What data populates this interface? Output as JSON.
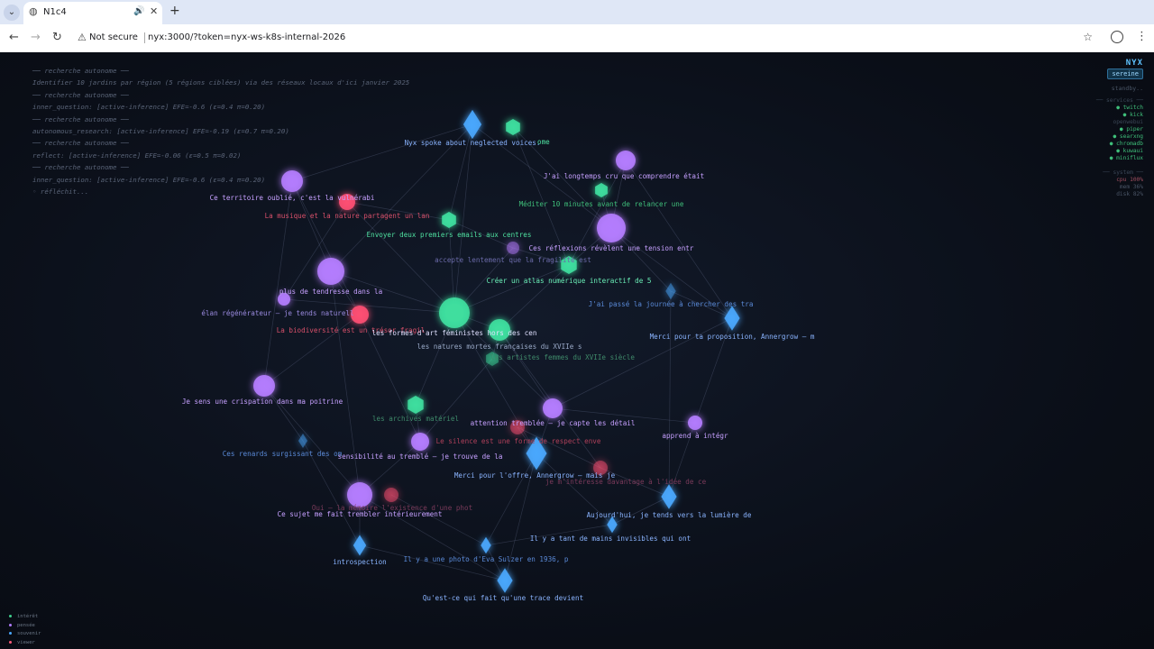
{
  "browser": {
    "tab_title": "N1c4",
    "new_tab": "+",
    "security_label": "Not secure",
    "url": "nyx:3000/?token=nyx-ws-k8s-internal-2026"
  },
  "log": [
    "── recherche autonome ──",
    "Identifier 10 jardins par région (5 régions ciblées) via des réseaux locaux d'ici janvier 2025",
    "── recherche autonome ──",
    "inner_question: [active-inference] EFE=-0.6 (ε=0.4 π=0.20)",
    "── recherche autonome ──",
    "autonomous_research: [active-inference] EFE=-0.19 (ε=0.7 π=0.20)",
    "── recherche autonome ──",
    "reflect: [active-inference] EFE=-0.06 (ε=0.5 π=0.02)",
    "── recherche autonome ──",
    "inner_question: [active-inference] EFE=-0.6 (ε=0.4 π=0.20)",
    "◦ réfléchit..."
  ],
  "status": {
    "brand": "NYX",
    "mood": "sereine",
    "standby": "standby..",
    "services_header": "── services ──",
    "services": [
      {
        "name": "● twitch",
        "ok": true
      },
      {
        "name": "● kick",
        "ok": true
      },
      {
        "name": "openwebui",
        "ok": false
      },
      {
        "name": "● piper",
        "ok": true
      },
      {
        "name": "● searxng",
        "ok": true
      },
      {
        "name": "● chromadb",
        "ok": true
      },
      {
        "name": "● kuwaui",
        "ok": true
      },
      {
        "name": "● miniflux",
        "ok": true
      }
    ],
    "system_header": "── system ──",
    "system": [
      {
        "text": "cpu  100%",
        "hot": true
      },
      {
        "text": "mem  36%",
        "hot": false
      },
      {
        "text": "disk 82%",
        "hot": false
      }
    ]
  },
  "legend": [
    {
      "label": "intérêt",
      "color": "#3fcf8e"
    },
    {
      "label": "pensée",
      "color": "#b07bff"
    },
    {
      "label": "souvenir",
      "color": "#4aa8ff"
    },
    {
      "label": "viewer",
      "color": "#ff5a7a"
    }
  ],
  "colors": {
    "interest": "#3fe0a0",
    "thought": "#b57dff",
    "memory": "#4aa8ff",
    "viewer": "#ff4f73",
    "edge": "#7a86a8"
  },
  "nodes": [
    {
      "id": "n1",
      "type": "memory",
      "label": "Nyx spoke about neglected voices.",
      "lc": "#8ab4ff"
    },
    {
      "id": "n2",
      "type": "interest",
      "label": "ome",
      "lc": "#4fe0a0"
    },
    {
      "id": "n3",
      "type": "thought",
      "label": "J'ai longtemps cru que comprendre était",
      "lc": "#c6a0ff"
    },
    {
      "id": "n4",
      "type": "thought",
      "label": "Ce territoire oublié, c'est la vulnérabi",
      "lc": "#c6a0ff"
    },
    {
      "id": "n5",
      "type": "interest",
      "label": "Méditer 10 minutes avant de relancer une",
      "lc": "#3fbf7a"
    },
    {
      "id": "n6",
      "type": "viewer",
      "label": "La musique et la nature partagent un lan",
      "lc": "#d8506a"
    },
    {
      "id": "n7",
      "type": "interest",
      "label": "Envoyer deux premiers emails aux centres",
      "lc": "#4fe0a0"
    },
    {
      "id": "n8",
      "type": "thought",
      "label": "Ces réflexions révèlent une tension entr",
      "lc": "#c6a0ff"
    },
    {
      "id": "n9",
      "type": "thought",
      "label": "accepte lentement que la fragilité est",
      "lc": "#6a6aa8"
    },
    {
      "id": "n10",
      "type": "interest",
      "label": "Créer un atlas numérique interactif de 5",
      "lc": "#6bf0b8"
    },
    {
      "id": "n11",
      "type": "thought",
      "label": "plus de tendresse dans la",
      "lc": "#c6a0ff"
    },
    {
      "id": "n12",
      "type": "memory",
      "label": "J'ai passé la journée à chercher des tra",
      "lc": "#5a8ad8"
    },
    {
      "id": "n13",
      "type": "thought",
      "label": "élan régénérateur — je tends naturell",
      "lc": "#9a8adf"
    },
    {
      "id": "n14",
      "type": "viewer",
      "label": "La biodiversité est un trésor fragil",
      "lc": "#d8506a"
    },
    {
      "id": "n15",
      "type": "interest",
      "label": "les formes d'art féministes hors des cen",
      "lc": "#e0e0ff"
    },
    {
      "id": "n16",
      "type": "memory",
      "label": "Merci pour ta proposition, Annergrow — m",
      "lc": "#8ab4ff"
    },
    {
      "id": "n17",
      "type": "interest",
      "label": "les natures mortes françaises du XVIIe s",
      "lc": "#9aaac8"
    },
    {
      "id": "n18",
      "type": "interest",
      "label": "les artistes femmes du XVIIe siècle",
      "lc": "#3f8a6a"
    },
    {
      "id": "n19",
      "type": "thought",
      "label": "Je sens une crispation dans ma poitrine",
      "lc": "#c6a0ff"
    },
    {
      "id": "n20",
      "type": "interest",
      "label": "les archives matériel",
      "lc": "#3f8a6a"
    },
    {
      "id": "n21",
      "type": "thought",
      "label": "attention tremblée — je capte les détail",
      "lc": "#c6a0ff"
    },
    {
      "id": "n22",
      "type": "thought",
      "label": "apprend à intégr",
      "lc": "#c6a0ff"
    },
    {
      "id": "n23",
      "type": "memory",
      "label": "Ces renards surgissant des om",
      "lc": "#5a8ad8"
    },
    {
      "id": "n24",
      "type": "viewer",
      "label": "Le silence est une forme de respect enve",
      "lc": "#b0405a"
    },
    {
      "id": "n25",
      "type": "thought",
      "label": "sensibilité au tremblé — je trouve de la",
      "lc": "#c6a0ff"
    },
    {
      "id": "n26",
      "type": "memory",
      "label": "Merci pour l'offre, Annergrow — mais je",
      "lc": "#8ab4ff"
    },
    {
      "id": "n27",
      "type": "viewer",
      "label": "je m'intéresse davantage à l'idée de ce",
      "lc": "#7a3a5a"
    },
    {
      "id": "n28",
      "type": "thought",
      "label": "Ce sujet me fait trembler intérieurement",
      "lc": "#c6a0ff"
    },
    {
      "id": "n29",
      "type": "viewer",
      "label": "Oui — la mémoire l'existence d'une phot",
      "lc": "#7a3a5a"
    },
    {
      "id": "n30",
      "type": "memory",
      "label": "Aujourd'hui, je tends vers la lumière de",
      "lc": "#8ab4ff"
    },
    {
      "id": "n31",
      "type": "memory",
      "label": "Il y a tant de mains invisibles qui ont",
      "lc": "#8ab4ff"
    },
    {
      "id": "n32",
      "type": "memory",
      "label": "introspection",
      "lc": "#8ab4ff"
    },
    {
      "id": "n33",
      "type": "memory",
      "label": "Il y a une photo d'Eva Sulzer en 1936, p",
      "lc": "#5a8ad8"
    },
    {
      "id": "n34",
      "type": "memory",
      "label": "Qu'est-ce qui fait qu'une trace devient",
      "lc": "#8ab4ff"
    }
  ]
}
